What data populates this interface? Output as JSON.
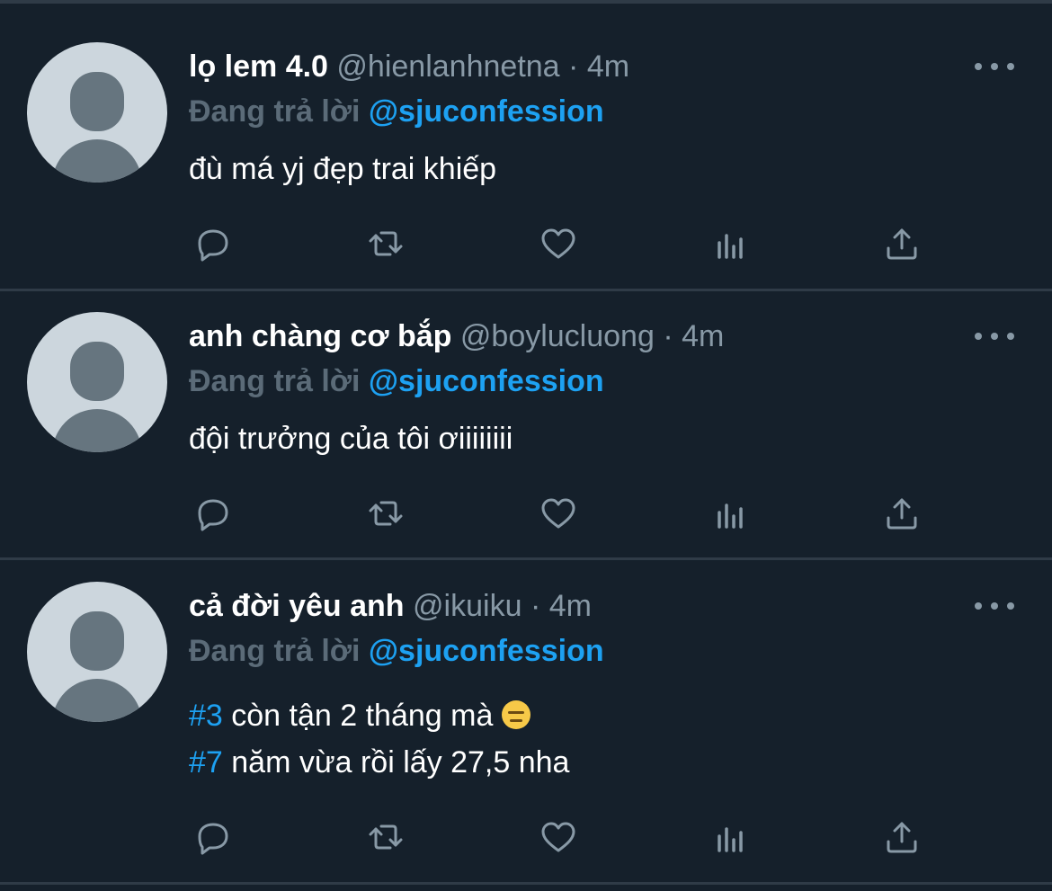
{
  "tweets": [
    {
      "display_name": "lọ lem 4.0",
      "handle": "@hienlanhnetna",
      "separator": "·",
      "time": "4m",
      "reply_prefix": "Đang trả lời",
      "reply_to": "@sjuconfession",
      "text_lines": [
        {
          "hashtag": "",
          "text": "đù má yj đẹp trai khiếp"
        }
      ]
    },
    {
      "display_name": "anh chàng cơ bắp",
      "handle": "@boylucluong",
      "separator": "·",
      "time": "4m",
      "reply_prefix": "Đang trả lời",
      "reply_to": "@sjuconfession",
      "text_lines": [
        {
          "hashtag": "",
          "text": "đội trưởng của tôi ơiiiiiiii"
        }
      ]
    },
    {
      "display_name": "cả đời yêu anh",
      "handle": "@ikuiku",
      "separator": "·",
      "time": "4m",
      "reply_prefix": "Đang trả lời",
      "reply_to": "@sjuconfession",
      "text_lines": [
        {
          "hashtag": "#3",
          "text": " còn tận 2 tháng mà ",
          "emoji": "expressionless-face-emoji"
        },
        {
          "hashtag": "#7",
          "text": " năm vừa rồi lấy 27,5 nha"
        }
      ]
    }
  ],
  "action_icons": [
    "reply-icon",
    "retweet-icon",
    "like-icon",
    "analytics-icon",
    "share-icon"
  ],
  "colors": {
    "background": "#15202b",
    "divider": "#2f3b47",
    "text": "#ffffff",
    "secondary": "#8899a6",
    "link": "#1da1f2"
  }
}
